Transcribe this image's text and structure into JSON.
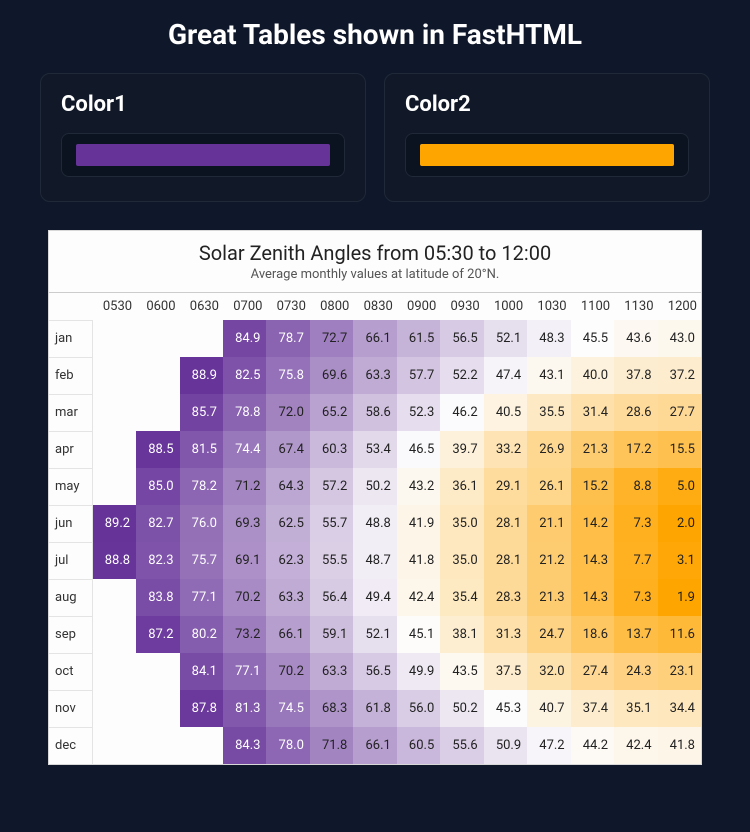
{
  "page_title": "Great Tables shown in FastHTML",
  "pickers": [
    {
      "label": "Color1",
      "color": "#663399"
    },
    {
      "label": "Color2",
      "color": "#FFA500"
    }
  ],
  "chart_data": {
    "type": "heatmap",
    "title": "Solar Zenith Angles from 05:30 to 12:00",
    "subtitle": "Average monthly values at latitude of 20°N.",
    "xlabel": "",
    "ylabel": "",
    "color_axis": {
      "low_color": "#663399",
      "high_color": "#FFA500",
      "range_approx": [
        0,
        90
      ]
    },
    "columns": [
      "0530",
      "0600",
      "0630",
      "0700",
      "0730",
      "0800",
      "0830",
      "0900",
      "0930",
      "1000",
      "1030",
      "1100",
      "1130",
      "1200"
    ],
    "rows": [
      "jan",
      "feb",
      "mar",
      "apr",
      "may",
      "jun",
      "jul",
      "aug",
      "sep",
      "oct",
      "nov",
      "dec"
    ],
    "data": {
      "jan": [
        null,
        null,
        null,
        84.9,
        78.7,
        72.7,
        66.1,
        61.5,
        56.5,
        52.1,
        48.3,
        45.5,
        43.6,
        43.0
      ],
      "feb": [
        null,
        null,
        88.9,
        82.5,
        75.8,
        69.6,
        63.3,
        57.7,
        52.2,
        47.4,
        43.1,
        40.0,
        37.8,
        37.2
      ],
      "mar": [
        null,
        null,
        85.7,
        78.8,
        72.0,
        65.2,
        58.6,
        52.3,
        46.2,
        40.5,
        35.5,
        31.4,
        28.6,
        27.7
      ],
      "apr": [
        null,
        88.5,
        81.5,
        74.4,
        67.4,
        60.3,
        53.4,
        46.5,
        39.7,
        33.2,
        26.9,
        21.3,
        17.2,
        15.5
      ],
      "may": [
        null,
        85.0,
        78.2,
        71.2,
        64.3,
        57.2,
        50.2,
        43.2,
        36.1,
        29.1,
        26.1,
        15.2,
        8.8,
        5.0
      ],
      "jun": [
        89.2,
        82.7,
        76.0,
        69.3,
        62.5,
        55.7,
        48.8,
        41.9,
        35.0,
        28.1,
        21.1,
        14.2,
        7.3,
        2.0
      ],
      "jul": [
        88.8,
        82.3,
        75.7,
        69.1,
        62.3,
        55.5,
        48.7,
        41.8,
        35.0,
        28.1,
        21.2,
        14.3,
        7.7,
        3.1
      ],
      "aug": [
        null,
        83.8,
        77.1,
        70.2,
        63.3,
        56.4,
        49.4,
        42.4,
        35.4,
        28.3,
        21.3,
        14.3,
        7.3,
        1.9
      ],
      "sep": [
        null,
        87.2,
        80.2,
        73.2,
        66.1,
        59.1,
        52.1,
        45.1,
        38.1,
        31.3,
        24.7,
        18.6,
        13.7,
        11.6
      ],
      "oct": [
        null,
        null,
        84.1,
        77.1,
        70.2,
        63.3,
        56.5,
        49.9,
        43.5,
        37.5,
        32.0,
        27.4,
        24.3,
        23.1
      ],
      "nov": [
        null,
        null,
        87.8,
        81.3,
        74.5,
        68.3,
        61.8,
        56.0,
        50.2,
        45.3,
        40.7,
        37.4,
        35.1,
        34.4
      ],
      "dec": [
        null,
        null,
        null,
        84.3,
        78.0,
        71.8,
        66.1,
        60.5,
        55.6,
        50.9,
        47.2,
        44.2,
        42.4,
        41.8
      ]
    },
    "value_min_shown": 1.9,
    "value_max_shown": 89.2
  }
}
